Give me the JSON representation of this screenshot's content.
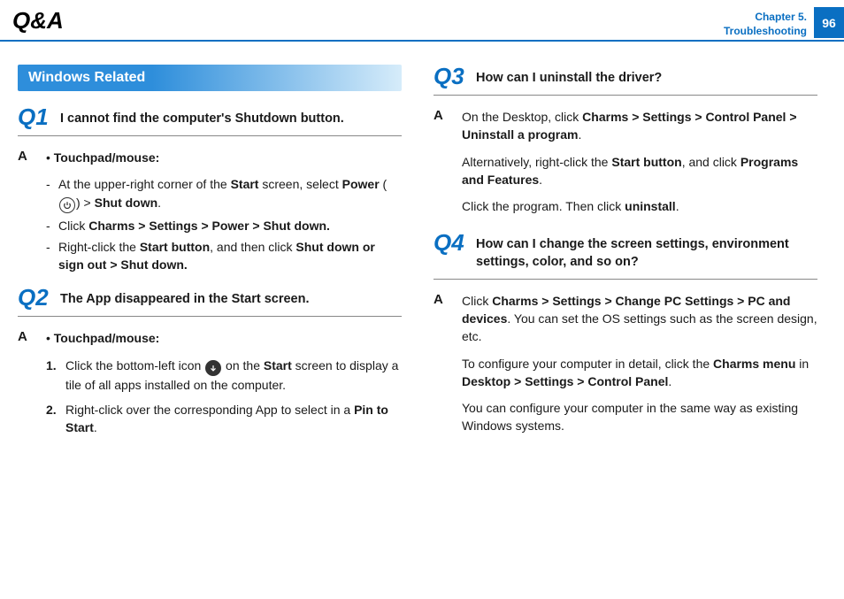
{
  "header": {
    "title": "Q&A",
    "chapter_line1": "Chapter 5.",
    "chapter_line2": "Troubleshooting",
    "page_number": "96"
  },
  "section_title": "Windows Related",
  "q1": {
    "label": "Q1",
    "text": "I cannot find the computer's Shutdown button.",
    "a_label": "A",
    "subhead": "Touchpad/mouse:",
    "b1_pre": "At the upper-right corner of the ",
    "b1_start": "Start",
    "b1_mid": " screen, select ",
    "b1_power": "Power",
    "b1_paren_open": " (",
    "b1_paren_close": ") > ",
    "b1_shutdown": "Shut down",
    "b1_period": ".",
    "b2_pre": "Click ",
    "b2_bold": "Charms > Settings > Power > Shut down.",
    "b3_pre": "Right-click the ",
    "b3_sb": "Start button",
    "b3_mid": ", and then click ",
    "b3_bold": "Shut down or sign out > Shut down."
  },
  "q2": {
    "label": "Q2",
    "text": "The App disappeared in the Start screen.",
    "a_label": "A",
    "subhead": "Touchpad/mouse:",
    "s1_num": "1.",
    "s1_pre": "Click the bottom-left icon ",
    "s1_mid": " on the ",
    "s1_start": "Start",
    "s1_post": " screen to display a tile of all apps installed on the computer.",
    "s2_num": "2.",
    "s2_pre": "Right-click over the corresponding App to select in a ",
    "s2_bold": "Pin to Start",
    "s2_period": "."
  },
  "q3": {
    "label": "Q3",
    "text": "How can I uninstall the driver?",
    "a_label": "A",
    "p1_pre": "On the Desktop, click ",
    "p1_bold": "Charms > Settings > Control Panel > Uninstall a program",
    "p1_period": ".",
    "p2_pre": "Alternatively, right-click the ",
    "p2_sb": "Start button",
    "p2_mid": ", and click ",
    "p2_pf": "Programs and Features",
    "p2_period": ".",
    "p3_pre": "Click the program. Then click ",
    "p3_bold": "uninstall",
    "p3_period": "."
  },
  "q4": {
    "label": "Q4",
    "text": "How can I change the screen settings, environment settings, color, and so on?",
    "a_label": "A",
    "p1_pre": "Click ",
    "p1_bold": "Charms > Settings > Change PC Settings > PC and devices",
    "p1_post": ". You can set the OS settings such as the screen design, etc.",
    "p2_pre": "To configure your computer in detail, click the ",
    "p2_cm": "Charms menu",
    "p2_in": " in ",
    "p2_path": "Desktop > Settings > Control Panel",
    "p2_period": ".",
    "p3": "You can configure your computer in the same way as existing Windows systems."
  }
}
